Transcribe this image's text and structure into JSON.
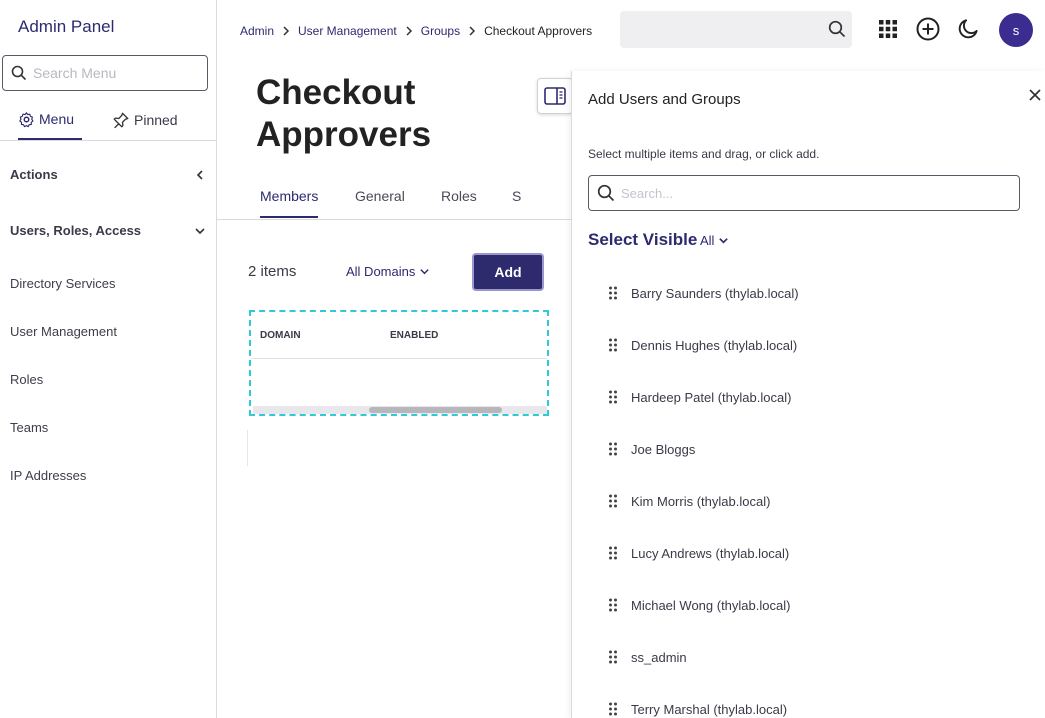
{
  "sidebar": {
    "brand": "Admin Panel",
    "search_placeholder": "Search Menu",
    "tabs": {
      "menu": "Menu",
      "pinned": "Pinned"
    },
    "sections": {
      "actions": "Actions",
      "users_roles_access": "Users, Roles, Access"
    },
    "links": [
      "Directory Services",
      "User Management",
      "Roles",
      "Teams",
      "IP Addresses"
    ]
  },
  "header": {
    "breadcrumb": [
      "Admin",
      "User Management",
      "Groups",
      "Checkout Approvers"
    ],
    "avatar_letter": "s",
    "icons": [
      "search-icon",
      "apps-grid-icon",
      "add-circle-icon",
      "moon-icon"
    ]
  },
  "main": {
    "title": "Checkout Approvers",
    "tabs": [
      "Members",
      "General",
      "Roles",
      "S"
    ],
    "active_tab": "Members",
    "count": "2 items",
    "domain_filter": "All Domains",
    "add_label": "Add",
    "columns": [
      "DOMAIN",
      "ENABLED"
    ]
  },
  "drawer": {
    "title": "Add Users and Groups",
    "hint": "Select multiple items and drag, or click add.",
    "search_placeholder": "Search...",
    "select_visible": "Select Visible",
    "filter": "All",
    "items": [
      "Barry Saunders (thylab.local)",
      "Dennis Hughes (thylab.local)",
      "Hardeep Patel (thylab.local)",
      "Joe Bloggs",
      "Kim Morris (thylab.local)",
      "Lucy Andrews (thylab.local)",
      "Michael Wong (thylab.local)",
      "ss_admin",
      "Terry Marshal (thylab.local)"
    ]
  },
  "colors": {
    "brand": "#2d2a6e",
    "avatar": "#3b2d8f",
    "highlight": "#2ecbd6"
  }
}
